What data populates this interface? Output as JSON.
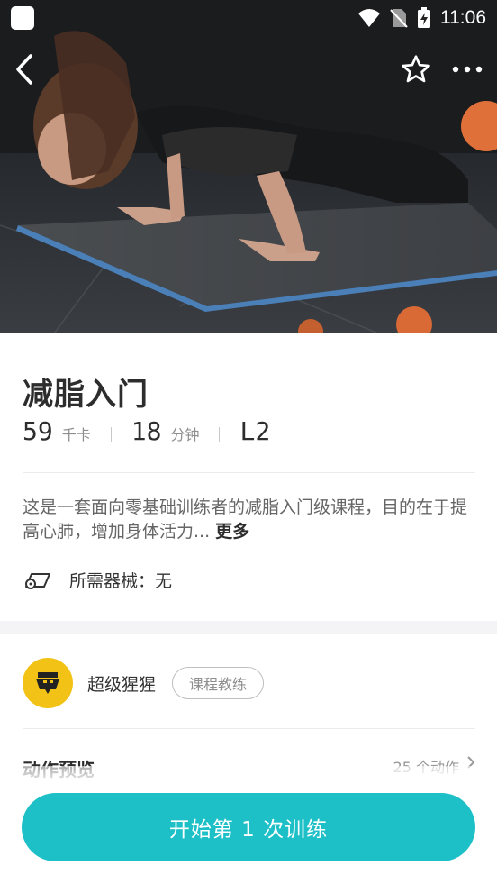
{
  "status_bar": {
    "time": "11:06"
  },
  "course": {
    "title": "减脂入门",
    "calories": {
      "value": "59",
      "unit": "千卡"
    },
    "duration": {
      "value": "18",
      "unit": "分钟"
    },
    "level": "L2",
    "description": "这是一套面向零基础训练者的减脂入门级课程，目的在于提高心肺，增加身体活力...",
    "more_label": "更多",
    "equipment_label": "所需器械：无"
  },
  "coach": {
    "name": "超级猩猩",
    "tag": "课程教练"
  },
  "preview": {
    "title": "动作预览",
    "count": "25 个动作"
  },
  "cta": {
    "label": "开始第 1 次训练"
  },
  "icons": {
    "back": "chevron-left-icon",
    "favorite": "star-outline-icon",
    "more": "more-horizontal-icon",
    "equipment": "equipment-icon"
  },
  "colors": {
    "accent": "#1ec0c8",
    "avatar_bg": "#f2c316"
  }
}
